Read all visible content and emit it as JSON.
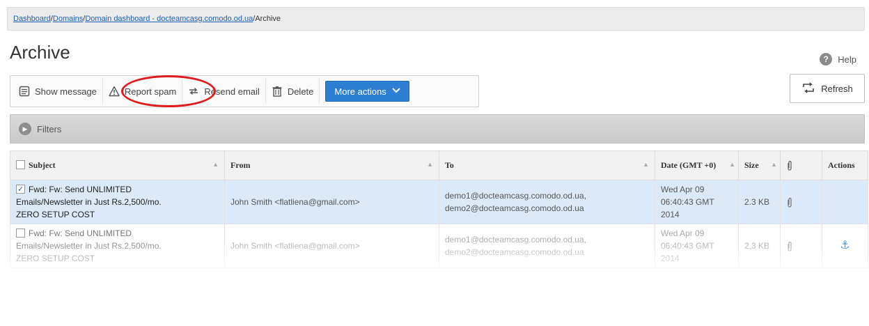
{
  "breadcrumb": {
    "items": [
      "Dashboard",
      "Domains",
      "Domain dashboard - docteamcasg.comodo.od.ua"
    ],
    "current": "Archive",
    "separator": "/"
  },
  "page_title": "Archive",
  "help_label": "Help",
  "toolbar": {
    "show_message": "Show message",
    "report_spam": "Report spam",
    "resend_email": "Resend email",
    "delete": "Delete",
    "more_actions": "More actions"
  },
  "refresh_label": "Refresh",
  "filters_label": "Filters",
  "table": {
    "columns": {
      "subject": "Subject",
      "from": "From",
      "to": "To",
      "date": "Date (GMT +0)",
      "size": "Size",
      "actions": "Actions"
    },
    "rows": [
      {
        "subject_1": "Fwd: Fw: Send UNLIMITED",
        "subject_2": "Emails/Newsletter in Just Rs.2,500/mo.",
        "subject_3": "ZERO SETUP COST",
        "from": "John Smith <flatliena@gmail.com>",
        "to_1": "demo1@docteamcasg.comodo.od.ua,",
        "to_2": "demo2@docteamcasg.comodo.od.ua",
        "date_1": "Wed Apr 09",
        "date_2": "06:40:43 GMT",
        "date_3": "2014",
        "size": "2.3 KB",
        "checked": true
      },
      {
        "subject_1": "Fwd: Fw: Send UNLIMITED",
        "subject_2": "Emails/Newsletter in Just Rs.2,500/mo.",
        "subject_3": "ZERO SETUP COST",
        "from": "John Smith <flatliena@gmail.com>",
        "to_1": "demo1@docteamcasg.comodo.od.ua,",
        "to_2": "demo2@docteamcasg.comodo.od.ua",
        "date_1": "Wed Apr 09",
        "date_2": "06:40:43 GMT",
        "date_3": "2014",
        "size": "2.3 KB",
        "checked": false
      }
    ]
  },
  "colors": {
    "accent": "#2d7fd3",
    "highlight_ring": "#e01a1a",
    "selected_row": "#dce9f8"
  },
  "icons": [
    "message-icon",
    "warning-icon",
    "resend-icon",
    "trash-icon",
    "chevron-down-icon",
    "refresh-icon",
    "help-icon",
    "filter-toggle-icon",
    "paperclip-icon",
    "anchor-icon"
  ]
}
